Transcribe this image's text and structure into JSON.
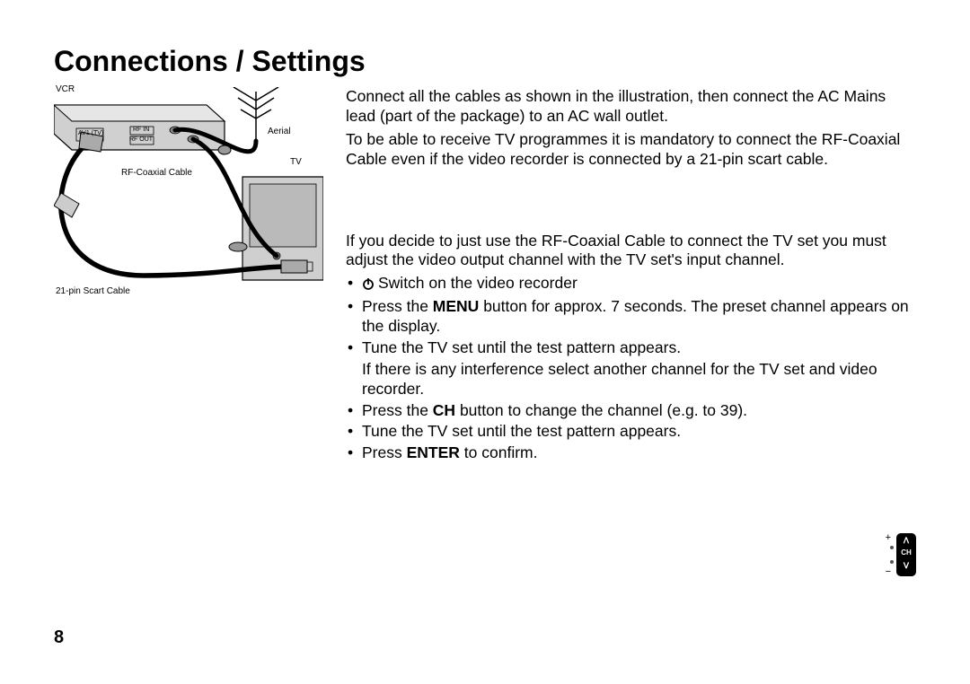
{
  "title": "Connections / Settings",
  "intro": {
    "p1": "Connect all the cables as shown in the illustration, then connect the AC Mains lead (part of the package) to an AC wall outlet.",
    "p2": "To be able to receive TV programmes it is mandatory to connect the RF-Coaxial Cable even if the video recorder is connected by a 21-pin scart cable."
  },
  "midpara": "If you decide to just use the RF-Coaxial Cable to connect the TV set you must adjust the video output channel with the TV set's input channel.",
  "bullets": {
    "b1": "Switch on the video recorder",
    "b2a": "Press the ",
    "b2b": "MENU",
    "b2c": " button for approx. 7 seconds. The preset channel appears on the display.",
    "b3": "Tune the TV set until the test pattern appears.",
    "b3x": "If there is any interference select another channel for the TV set and video recorder.",
    "b4a": "Press the ",
    "b4b": "CH",
    "b4c": " button to change the channel (e.g. to  39).",
    "b5": "Tune the TV set until the test pattern appears.",
    "b6a": "Press ",
    "b6b": "ENTER",
    "b6c": " to confirm."
  },
  "figure": {
    "vcr": "VCR",
    "aerial": "Aerial",
    "tv": "TV",
    "rfcoax": "RF-Coaxial Cable",
    "scart": "21-pin Scart Cable",
    "av1": "AV1 (TV)",
    "rfin": "RF IN",
    "rfout": "RF OUT"
  },
  "ch_button": {
    "up": "ᐱ",
    "label": "CH",
    "down": "ᐯ",
    "plus": "+",
    "minus": "−"
  },
  "page_number": "8"
}
